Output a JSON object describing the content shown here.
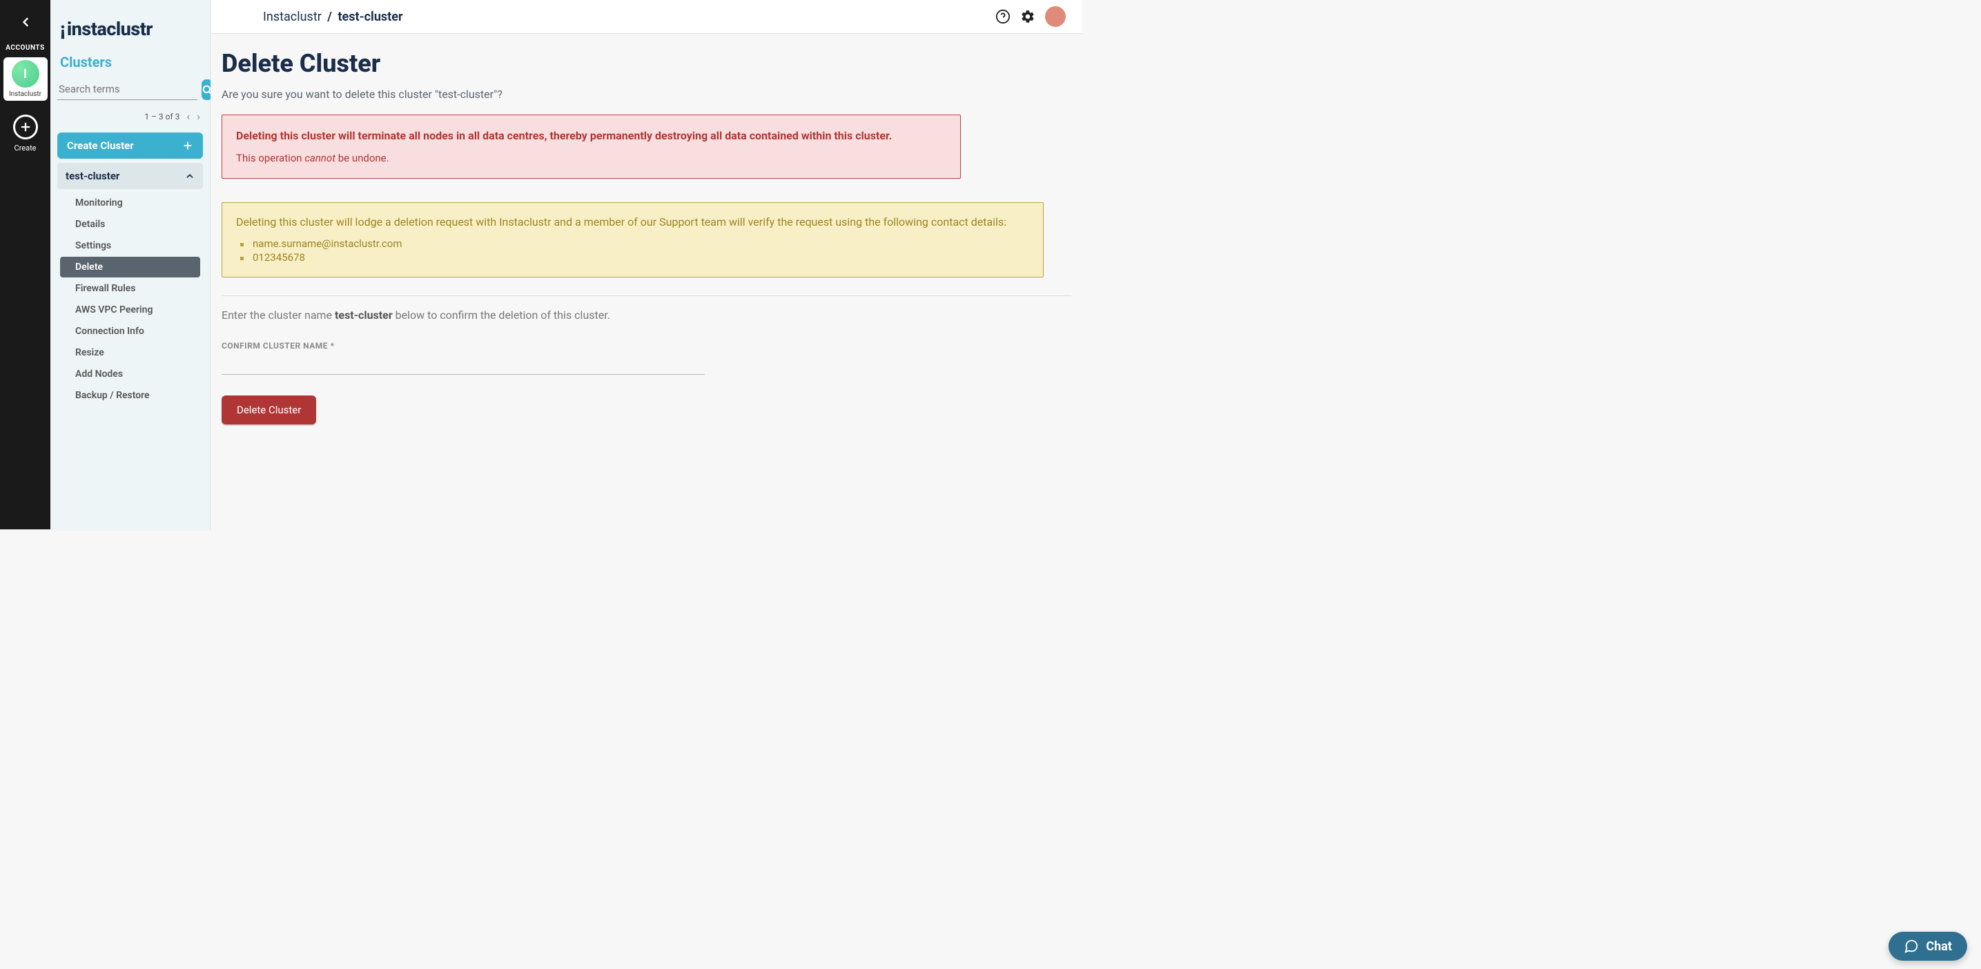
{
  "leftrail": {
    "accounts_label": "ACCOUNTS",
    "avatar_letter": "I",
    "account_name": "Instaclustr",
    "create_label": "Create"
  },
  "sidebar": {
    "logo": "instaclustr",
    "heading": "Clusters",
    "search_placeholder": "Search terms",
    "pager_text": "1 – 3 of 3",
    "create_cluster": "Create Cluster",
    "cluster_name": "test-cluster",
    "nav": [
      {
        "label": "Monitoring"
      },
      {
        "label": "Details"
      },
      {
        "label": "Settings"
      },
      {
        "label": "Delete"
      },
      {
        "label": "Firewall Rules"
      },
      {
        "label": "AWS VPC Peering"
      },
      {
        "label": "Connection Info"
      },
      {
        "label": "Resize"
      },
      {
        "label": "Add Nodes"
      },
      {
        "label": "Backup / Restore"
      }
    ]
  },
  "topbar": {
    "crumb_root": "Instaclustr",
    "crumb_sep": "/",
    "crumb_current": "test-cluster"
  },
  "page": {
    "title": "Delete Cluster",
    "subtitle": "Are you sure you want to delete this cluster \"test-cluster\"?",
    "danger_line1": "Deleting this cluster will terminate all nodes in all data centres, thereby permanently destroying all data contained within this cluster.",
    "danger_prefix": "This operation ",
    "danger_em": "cannot",
    "danger_suffix": " be undone.",
    "warn_msg": "Deleting this cluster will lodge a deletion request with Instaclustr and a member of our Support team will verify the request using the following contact details:",
    "warn_contacts": [
      "name.surname@instaclustr.com",
      "012345678"
    ],
    "confirm_prefix": "Enter the cluster name ",
    "confirm_bold": "test-cluster",
    "confirm_suffix": " below to confirm the deletion of this cluster.",
    "field_label": "CONFIRM CLUSTER NAME *",
    "delete_button": "Delete Cluster"
  },
  "chat": {
    "label": "Chat"
  }
}
